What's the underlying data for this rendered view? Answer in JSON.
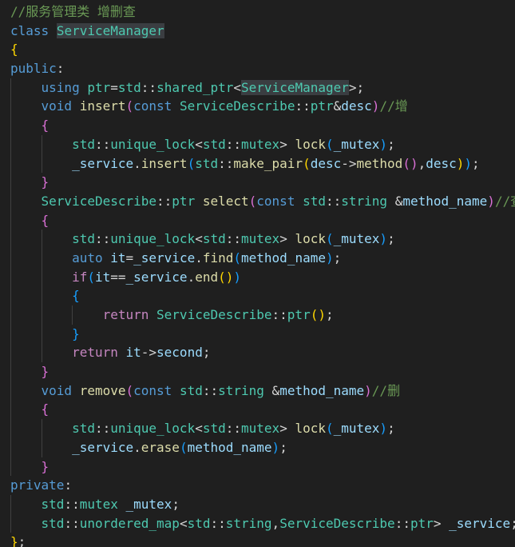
{
  "editor": {
    "theme": "dark",
    "colors": {
      "background": "#1f1f1f",
      "keyword": "#569cd6",
      "control": "#c586c0",
      "type": "#4ec9b0",
      "function": "#dcdcaa",
      "variable": "#9cdcfe",
      "comment": "#6a9955",
      "bracket_1": "#ffd700",
      "bracket_2": "#da70d6",
      "bracket_3": "#179fff"
    },
    "lines": [
      {
        "indent": 0,
        "tokens": [
          [
            "cm",
            "//服务管理类 增删查"
          ]
        ]
      },
      {
        "indent": 0,
        "tokens": [
          [
            "kw",
            "class"
          ],
          [
            "op",
            " "
          ],
          [
            "type-hl",
            "ServiceManager"
          ]
        ]
      },
      {
        "indent": 0,
        "tokens": [
          [
            "b1",
            "{"
          ]
        ]
      },
      {
        "indent": 0,
        "tokens": [
          [
            "kw",
            "public"
          ],
          [
            "op",
            ":"
          ]
        ]
      },
      {
        "indent": 1,
        "tokens": [
          [
            "kw",
            "using"
          ],
          [
            "op",
            " "
          ],
          [
            "type",
            "ptr"
          ],
          [
            "op",
            "="
          ],
          [
            "type",
            "std"
          ],
          [
            "op",
            "::"
          ],
          [
            "type",
            "shared_ptr"
          ],
          [
            "op",
            "<"
          ],
          [
            "type-hl",
            "ServiceManager"
          ],
          [
            "op",
            ">;"
          ]
        ]
      },
      {
        "indent": 1,
        "tokens": [
          [
            "kw",
            "void"
          ],
          [
            "op",
            " "
          ],
          [
            "fn",
            "insert"
          ],
          [
            "b2",
            "("
          ],
          [
            "kw",
            "const"
          ],
          [
            "op",
            " "
          ],
          [
            "type",
            "ServiceDescribe"
          ],
          [
            "op",
            "::"
          ],
          [
            "type",
            "ptr"
          ],
          [
            "op",
            "&"
          ],
          [
            "var",
            "desc"
          ],
          [
            "b2",
            ")"
          ],
          [
            "cm",
            "//增"
          ]
        ]
      },
      {
        "indent": 1,
        "tokens": [
          [
            "b2",
            "{"
          ]
        ]
      },
      {
        "indent": 2,
        "tokens": [
          [
            "type",
            "std"
          ],
          [
            "op",
            "::"
          ],
          [
            "type",
            "unique_lock"
          ],
          [
            "op",
            "<"
          ],
          [
            "type",
            "std"
          ],
          [
            "op",
            "::"
          ],
          [
            "type",
            "mutex"
          ],
          [
            "op",
            "> "
          ],
          [
            "fn",
            "lock"
          ],
          [
            "b3",
            "("
          ],
          [
            "var",
            "_mutex"
          ],
          [
            "b3",
            ")"
          ],
          [
            "op",
            ";"
          ]
        ]
      },
      {
        "indent": 2,
        "tokens": [
          [
            "var",
            "_service"
          ],
          [
            "op",
            "."
          ],
          [
            "fn",
            "insert"
          ],
          [
            "b3",
            "("
          ],
          [
            "type",
            "std"
          ],
          [
            "op",
            "::"
          ],
          [
            "fn",
            "make_pair"
          ],
          [
            "b1",
            "("
          ],
          [
            "var",
            "desc"
          ],
          [
            "op",
            "->"
          ],
          [
            "fn",
            "method"
          ],
          [
            "b2",
            "()"
          ],
          [
            "op",
            ","
          ],
          [
            "var",
            "desc"
          ],
          [
            "b1",
            ")"
          ],
          [
            "b3",
            ")"
          ],
          [
            "op",
            ";"
          ]
        ]
      },
      {
        "indent": 1,
        "tokens": [
          [
            "b2",
            "}"
          ]
        ]
      },
      {
        "indent": 1,
        "tokens": [
          [
            "type",
            "ServiceDescribe"
          ],
          [
            "op",
            "::"
          ],
          [
            "type",
            "ptr"
          ],
          [
            "op",
            " "
          ],
          [
            "fn",
            "select"
          ],
          [
            "b2",
            "("
          ],
          [
            "kw",
            "const"
          ],
          [
            "op",
            " "
          ],
          [
            "type",
            "std"
          ],
          [
            "op",
            "::"
          ],
          [
            "type",
            "string"
          ],
          [
            "op",
            " &"
          ],
          [
            "var",
            "method_name"
          ],
          [
            "b2",
            ")"
          ],
          [
            "cm",
            "//查"
          ]
        ]
      },
      {
        "indent": 1,
        "tokens": [
          [
            "b2",
            "{"
          ]
        ]
      },
      {
        "indent": 2,
        "tokens": [
          [
            "type",
            "std"
          ],
          [
            "op",
            "::"
          ],
          [
            "type",
            "unique_lock"
          ],
          [
            "op",
            "<"
          ],
          [
            "type",
            "std"
          ],
          [
            "op",
            "::"
          ],
          [
            "type",
            "mutex"
          ],
          [
            "op",
            "> "
          ],
          [
            "fn",
            "lock"
          ],
          [
            "b3",
            "("
          ],
          [
            "var",
            "_mutex"
          ],
          [
            "b3",
            ")"
          ],
          [
            "op",
            ";"
          ]
        ]
      },
      {
        "indent": 2,
        "tokens": [
          [
            "kw",
            "auto"
          ],
          [
            "op",
            " "
          ],
          [
            "var",
            "it"
          ],
          [
            "op",
            "="
          ],
          [
            "var",
            "_service"
          ],
          [
            "op",
            "."
          ],
          [
            "fn",
            "find"
          ],
          [
            "b3",
            "("
          ],
          [
            "var",
            "method_name"
          ],
          [
            "b3",
            ")"
          ],
          [
            "op",
            ";"
          ]
        ]
      },
      {
        "indent": 2,
        "tokens": [
          [
            "ctrl",
            "if"
          ],
          [
            "b3",
            "("
          ],
          [
            "var",
            "it"
          ],
          [
            "op",
            "=="
          ],
          [
            "var",
            "_service"
          ],
          [
            "op",
            "."
          ],
          [
            "fn",
            "end"
          ],
          [
            "b1",
            "()"
          ],
          [
            "b3",
            ")"
          ]
        ]
      },
      {
        "indent": 2,
        "tokens": [
          [
            "b3",
            "{"
          ]
        ]
      },
      {
        "indent": 3,
        "tokens": [
          [
            "ctrl",
            "return"
          ],
          [
            "op",
            " "
          ],
          [
            "type",
            "ServiceDescribe"
          ],
          [
            "op",
            "::"
          ],
          [
            "type",
            "ptr"
          ],
          [
            "b1",
            "()"
          ],
          [
            "op",
            ";"
          ]
        ]
      },
      {
        "indent": 2,
        "tokens": [
          [
            "b3",
            "}"
          ]
        ]
      },
      {
        "indent": 2,
        "tokens": [
          [
            "ctrl",
            "return"
          ],
          [
            "op",
            " "
          ],
          [
            "var",
            "it"
          ],
          [
            "op",
            "->"
          ],
          [
            "var",
            "second"
          ],
          [
            "op",
            ";"
          ]
        ]
      },
      {
        "indent": 1,
        "tokens": [
          [
            "b2",
            "}"
          ]
        ]
      },
      {
        "indent": 1,
        "tokens": [
          [
            "kw",
            "void"
          ],
          [
            "op",
            " "
          ],
          [
            "fn",
            "remove"
          ],
          [
            "b2",
            "("
          ],
          [
            "kw",
            "const"
          ],
          [
            "op",
            " "
          ],
          [
            "type",
            "std"
          ],
          [
            "op",
            "::"
          ],
          [
            "type",
            "string"
          ],
          [
            "op",
            " &"
          ],
          [
            "var",
            "method_name"
          ],
          [
            "b2",
            ")"
          ],
          [
            "cm",
            "//删"
          ]
        ]
      },
      {
        "indent": 1,
        "tokens": [
          [
            "b2",
            "{"
          ]
        ]
      },
      {
        "indent": 2,
        "tokens": [
          [
            "type",
            "std"
          ],
          [
            "op",
            "::"
          ],
          [
            "type",
            "unique_lock"
          ],
          [
            "op",
            "<"
          ],
          [
            "type",
            "std"
          ],
          [
            "op",
            "::"
          ],
          [
            "type",
            "mutex"
          ],
          [
            "op",
            "> "
          ],
          [
            "fn",
            "lock"
          ],
          [
            "b3",
            "("
          ],
          [
            "var",
            "_mutex"
          ],
          [
            "b3",
            ")"
          ],
          [
            "op",
            ";"
          ]
        ]
      },
      {
        "indent": 2,
        "tokens": [
          [
            "var",
            "_service"
          ],
          [
            "op",
            "."
          ],
          [
            "fn",
            "erase"
          ],
          [
            "b3",
            "("
          ],
          [
            "var",
            "method_name"
          ],
          [
            "b3",
            ")"
          ],
          [
            "op",
            ";"
          ]
        ]
      },
      {
        "indent": 1,
        "tokens": [
          [
            "b2",
            "}"
          ]
        ]
      },
      {
        "indent": 0,
        "tokens": [
          [
            "kw",
            "private"
          ],
          [
            "op",
            ":"
          ]
        ]
      },
      {
        "indent": 1,
        "tokens": [
          [
            "type",
            "std"
          ],
          [
            "op",
            "::"
          ],
          [
            "type",
            "mutex"
          ],
          [
            "op",
            " "
          ],
          [
            "var",
            "_mutex"
          ],
          [
            "op",
            ";"
          ]
        ]
      },
      {
        "indent": 1,
        "tokens": [
          [
            "type",
            "std"
          ],
          [
            "op",
            "::"
          ],
          [
            "type",
            "unordered_map"
          ],
          [
            "op",
            "<"
          ],
          [
            "type",
            "std"
          ],
          [
            "op",
            "::"
          ],
          [
            "type",
            "string"
          ],
          [
            "op",
            ","
          ],
          [
            "type",
            "ServiceDescribe"
          ],
          [
            "op",
            "::"
          ],
          [
            "type",
            "ptr"
          ],
          [
            "op",
            "> "
          ],
          [
            "var",
            "_service"
          ],
          [
            "op",
            ";"
          ]
        ]
      },
      {
        "indent": 0,
        "tokens": [
          [
            "b1",
            "}"
          ],
          [
            "op",
            ";"
          ]
        ]
      }
    ]
  }
}
